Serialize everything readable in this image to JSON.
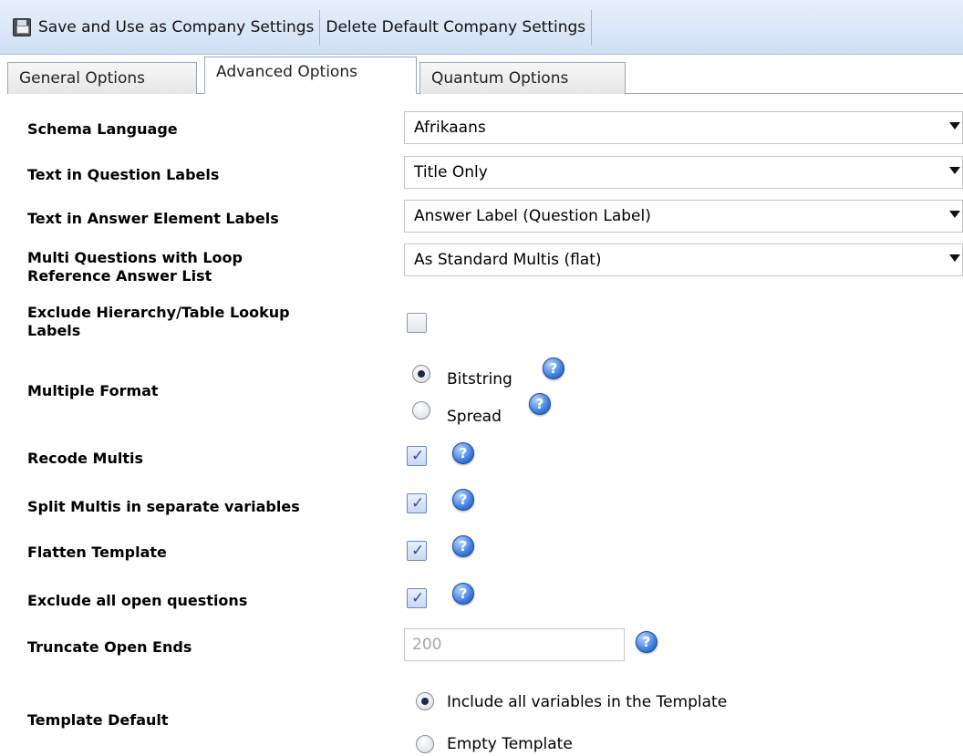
{
  "toolbar": {
    "save_label": "Save and Use as Company Settings",
    "delete_label": "Delete Default Company Settings"
  },
  "tabs": [
    {
      "label": "General Options",
      "active": false
    },
    {
      "label": "Advanced Options",
      "active": true
    },
    {
      "label": "Quantum Options",
      "active": false
    }
  ],
  "form": {
    "schema_language": {
      "label": "Schema Language",
      "value": "Afrikaans"
    },
    "question_labels": {
      "label": "Text in Question Labels",
      "value": "Title Only"
    },
    "answer_labels": {
      "label": "Text in Answer Element Labels",
      "value": "Answer Label (Question Label)"
    },
    "multi_loop": {
      "label_line1": "Multi Questions with Loop",
      "label_line2": "Reference Answer List",
      "value": "As Standard Multis (flat)"
    },
    "exclude_hierarchy": {
      "label_line1": "Exclude Hierarchy/Table Lookup",
      "label_line2": "Labels",
      "checked": false
    },
    "multiple_format": {
      "label": "Multiple Format",
      "options": [
        "Bitstring",
        "Spread"
      ],
      "selected": "Bitstring"
    },
    "recode_multis": {
      "label": "Recode Multis",
      "checked": true
    },
    "split_multis": {
      "label": "Split Multis in separate variables",
      "checked": true
    },
    "flatten_template": {
      "label": "Flatten Template",
      "checked": true
    },
    "exclude_open": {
      "label": "Exclude all open questions",
      "checked": true
    },
    "truncate_open_ends": {
      "label": "Truncate Open Ends",
      "placeholder": "200"
    },
    "template_default": {
      "label": "Template Default",
      "options": [
        "Include all variables in the Template",
        "Empty Template"
      ],
      "selected": "Include all variables in the Template"
    }
  },
  "icons": {
    "help": "help-icon",
    "save": "save-icon",
    "dropdown": "chevron-down-icon"
  },
  "help_glyph": "?",
  "check_glyph": "✓",
  "colors": {
    "toolbar_bg": "#d6e5f6",
    "help_blue": "#3e7fe0"
  }
}
